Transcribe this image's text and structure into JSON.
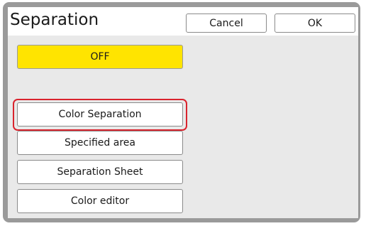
{
  "header": {
    "title": "Separation",
    "cancel_label": "Cancel",
    "ok_label": "OK"
  },
  "options": {
    "off_label": "OFF",
    "color_separation_label": "Color Separation",
    "specified_area_label": "Specified area",
    "separation_sheet_label": "Separation Sheet",
    "color_editor_label": "Color editor"
  },
  "colors": {
    "selected_fill": "#ffe400",
    "highlight_outline": "#d9232d",
    "frame": "#9a9a9a",
    "panel": "#e9e9e9"
  }
}
